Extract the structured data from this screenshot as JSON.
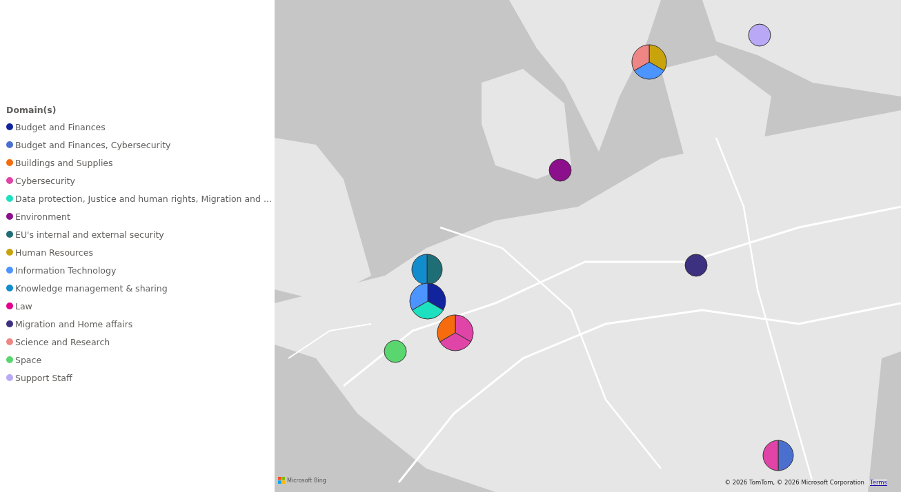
{
  "legend": {
    "title": "Domain(s)",
    "items": [
      {
        "label": "Budget and Finances",
        "color": "#12239e"
      },
      {
        "label": "Budget and Finances, Cybersecurity",
        "color": "#4a6fcf"
      },
      {
        "label": "Buildings and Supplies",
        "color": "#f56b0e"
      },
      {
        "label": "Cybersecurity",
        "color": "#e044a7"
      },
      {
        "label": "Data protection, Justice and human rights, Migration and ...",
        "color": "#1ce0c0"
      },
      {
        "label": "Environment",
        "color": "#8c0f8c"
      },
      {
        "label": "EU's internal and external security",
        "color": "#1f6e76"
      },
      {
        "label": "Human Resources",
        "color": "#c8a30c"
      },
      {
        "label": "Information Technology",
        "color": "#4c94ff"
      },
      {
        "label": "Knowledge management & sharing",
        "color": "#118dce"
      },
      {
        "label": "Law",
        "color": "#e3008c"
      },
      {
        "label": "Migration and Home affairs",
        "color": "#3c3080"
      },
      {
        "label": "Science and Research",
        "color": "#ef8686"
      },
      {
        "label": "Space",
        "color": "#5ad66e"
      },
      {
        "label": "Support Staff",
        "color": "#b9a8f5"
      }
    ]
  },
  "map": {
    "markers": [
      {
        "slices": [
          {
            "color": "#c8a30c"
          },
          {
            "color": "#4c94ff"
          },
          {
            "color": "#ef8686"
          }
        ]
      },
      {
        "slices": [
          {
            "color": "#b9a8f5"
          }
        ]
      },
      {
        "slices": [
          {
            "color": "#8c0f8c"
          }
        ]
      },
      {
        "slices": [
          {
            "color": "#3c3080"
          }
        ]
      },
      {
        "slices": [
          {
            "color": "#1f6e76"
          },
          {
            "color": "#118dce"
          }
        ]
      },
      {
        "slices": [
          {
            "color": "#12239e"
          },
          {
            "color": "#1ce0c0"
          },
          {
            "color": "#4c94ff"
          }
        ]
      },
      {
        "slices": [
          {
            "color": "#e044a7"
          },
          {
            "color": "#e044a7"
          },
          {
            "color": "#f56b0e"
          }
        ]
      },
      {
        "slices": [
          {
            "color": "#5ad66e"
          }
        ]
      },
      {
        "slices": [
          {
            "color": "#4a6fcf"
          },
          {
            "color": "#e044a7"
          }
        ]
      }
    ],
    "logo": "Microsoft Bing",
    "copyright": "© 2026 TomTom, © 2026 Microsoft Corporation",
    "terms": "Terms"
  }
}
